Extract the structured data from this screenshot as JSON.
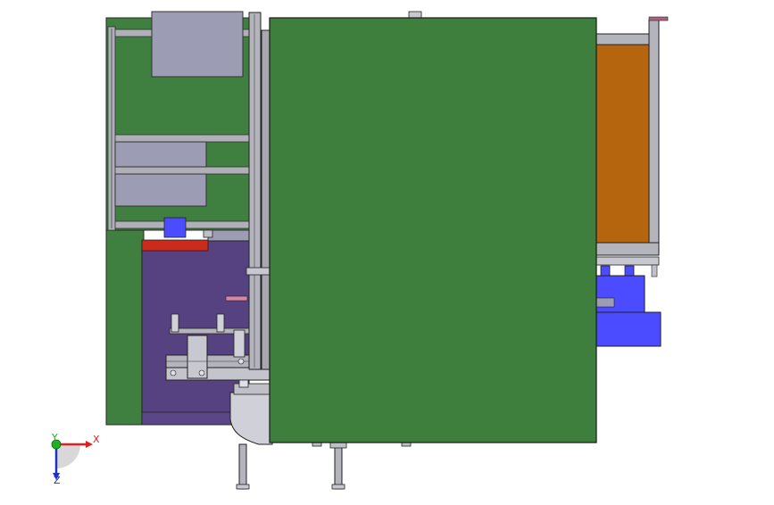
{
  "viewport": {
    "background": "#ffffff"
  },
  "triad": {
    "x_label": "X",
    "y_label": "Y",
    "z_label": "Z",
    "x_color": "#e02020",
    "y_color": "#20b020",
    "z_color": "#2030c0"
  },
  "model": {
    "colors": {
      "frame_green": "#3f7f3f",
      "front_panel_green": "#3e7f3e",
      "cabinet_purple": "#564280",
      "bin_orange": "#b5650e",
      "motor_blue": "#4b4bff",
      "steel_gray": "#a8a8b0",
      "panel_gray": "#9c9cb4",
      "red_cap": "#cc2a1a",
      "edge_dark": "#2a2a2a"
    }
  }
}
